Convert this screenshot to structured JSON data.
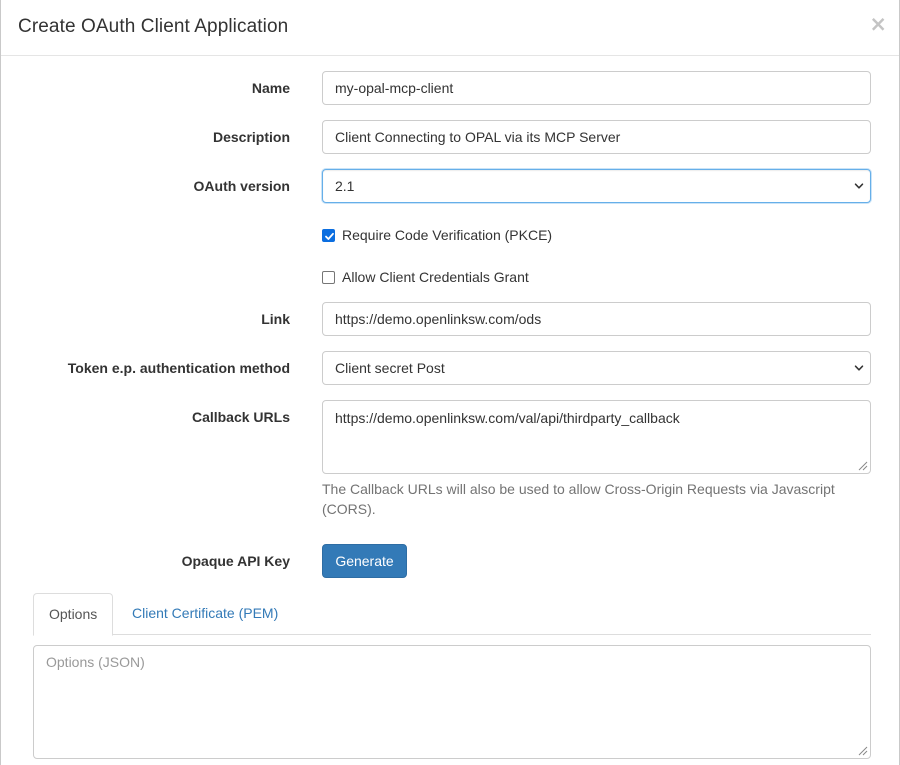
{
  "dialog": {
    "title": "Create OAuth Client Application",
    "close_glyph": "×"
  },
  "form": {
    "name": {
      "label": "Name",
      "value": "my-opal-mcp-client"
    },
    "description": {
      "label": "Description",
      "value": "Client Connecting to OPAL via its MCP Server"
    },
    "oauth_version": {
      "label": "OAuth version",
      "value": "2.1"
    },
    "pkce": {
      "label": "Require Code Verification (PKCE)",
      "checked": true
    },
    "client_credentials": {
      "label": "Allow Client Credentials Grant",
      "checked": false
    },
    "link": {
      "label": "Link",
      "value": "https://demo.openlinksw.com/ods"
    },
    "token_auth_method": {
      "label": "Token e.p. authentication method",
      "value": "Client secret Post"
    },
    "callback_urls": {
      "label": "Callback URLs",
      "value": "https://demo.openlinksw.com/val/api/thirdparty_callback",
      "help": "The Callback URLs will also be used to allow Cross-Origin Requests via Javascript (CORS)."
    },
    "opaque_api_key": {
      "label": "Opaque API Key",
      "button_label": "Generate"
    }
  },
  "tabs": [
    {
      "label": "Options",
      "active": true
    },
    {
      "label": "Client Certificate (PEM)",
      "active": false
    }
  ],
  "options_panel": {
    "placeholder": "Options (JSON)"
  },
  "colors": {
    "primary_button": "#337ab7",
    "focus_border": "#66afe9",
    "checkbox_checked": "#0b6ee0",
    "link": "#337ab7"
  },
  "icons": {
    "select_arrow": "chevron-down-icon",
    "checkmark": "check-icon",
    "resize": "resize-grip-icon"
  }
}
